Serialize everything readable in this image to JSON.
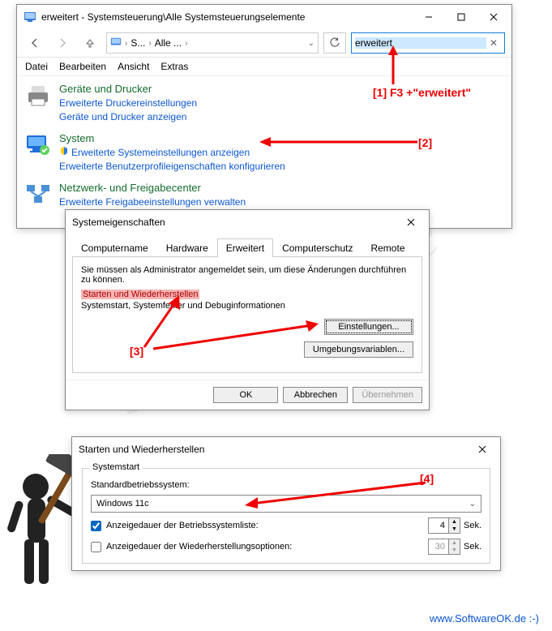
{
  "watermark": "SoftwareOK.de",
  "footer": "www.SoftwareOK.de :-)",
  "win1": {
    "title": "erweitert - Systemsteuerung\\Alle Systemsteuerungselemente",
    "breadcrumb": {
      "seg1": "S...",
      "seg2": "Alle ..."
    },
    "search_value": "erweitert",
    "menu": {
      "datei": "Datei",
      "bearbeiten": "Bearbeiten",
      "ansicht": "Ansicht",
      "extras": "Extras"
    },
    "results": {
      "r1": {
        "title": "Geräte und Drucker",
        "links": [
          "Erweiterte Druckereinstellungen",
          "Geräte und Drucker anzeigen"
        ]
      },
      "r2": {
        "title": "System",
        "links": [
          "Erweiterte Systemeinstellungen anzeigen",
          "Erweiterte Benutzerprofileigenschaften konfigurieren"
        ]
      },
      "r3": {
        "title": "Netzwerk- und Freigabecenter",
        "links": [
          "Erweiterte Freigabeeinstellungen verwalten"
        ]
      }
    }
  },
  "win2": {
    "title": "Systemeigenschaften",
    "tabs": {
      "t1": "Computername",
      "t2": "Hardware",
      "t3": "Erweitert",
      "t4": "Computerschutz",
      "t5": "Remote"
    },
    "note": "Sie müssen als Administrator angemeldet sein, um diese Änderungen durchführen zu können.",
    "section_label": "Starten und Wiederherstellen",
    "section_sub": "Systemstart, Systemfehler und Debuginformationen",
    "btn_settings": "Einstellungen...",
    "btn_env": "Umgebungsvariablen...",
    "btn_ok": "OK",
    "btn_cancel": "Abbrechen",
    "btn_apply": "Übernehmen"
  },
  "win3": {
    "title": "Starten und Wiederherstellen",
    "group": "Systemstart",
    "label_default": "Standardbetriebssystem:",
    "dropdown_value": "Windows 11c",
    "chk1_label": "Anzeigedauer der Betriebssystemliste:",
    "chk1_value": "4",
    "chk2_label": "Anzeigedauer der Wiederherstellungsoptionen:",
    "chk2_value": "30",
    "unit": "Sek."
  },
  "annotations": {
    "a1": "[1] F3 +\"erweitert\"",
    "a2": "[2]",
    "a3": "[3]",
    "a4": "[4]"
  }
}
